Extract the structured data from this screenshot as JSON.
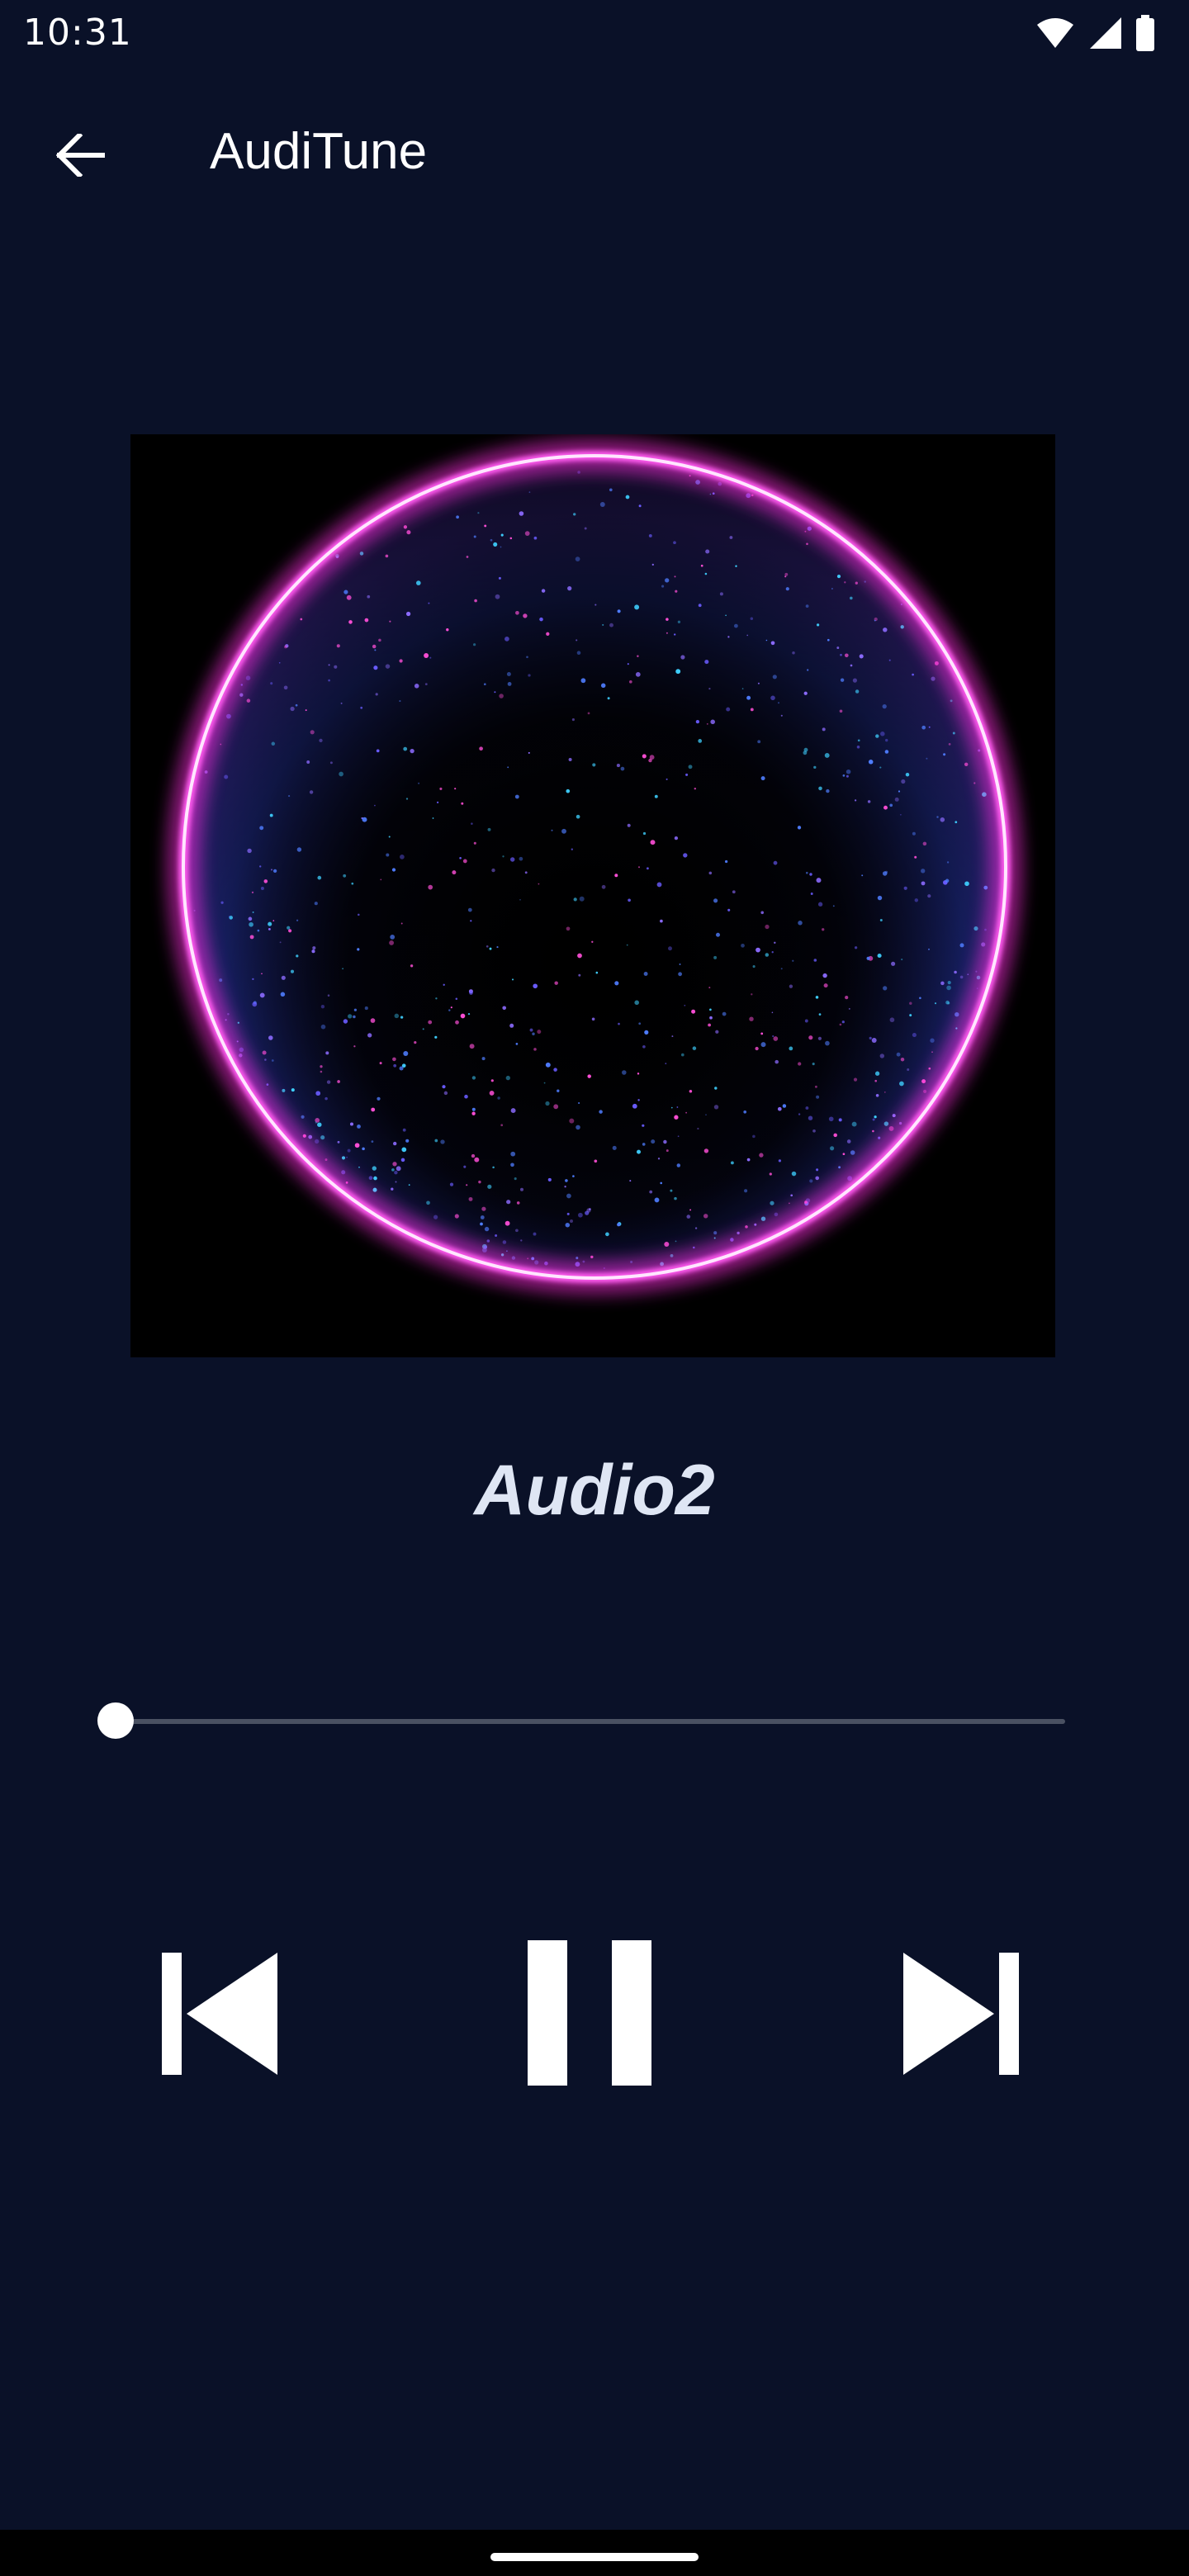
{
  "status_bar": {
    "time": "10:31",
    "icons": [
      "wifi-icon",
      "signal-icon",
      "battery-icon"
    ]
  },
  "app_bar": {
    "title": "AudiTune",
    "back_icon": "arrow-left-icon"
  },
  "player": {
    "track_title": "Audio2",
    "progress": 0.0,
    "controls": {
      "previous_icon": "skip-previous-icon",
      "pause_icon": "pause-icon",
      "next_icon": "skip-next-icon"
    }
  },
  "colors": {
    "background": "#0a1128",
    "accent_magenta": "#ff3de8",
    "accent_blue": "#3a6cff",
    "title_text": "#dfe6f4"
  }
}
